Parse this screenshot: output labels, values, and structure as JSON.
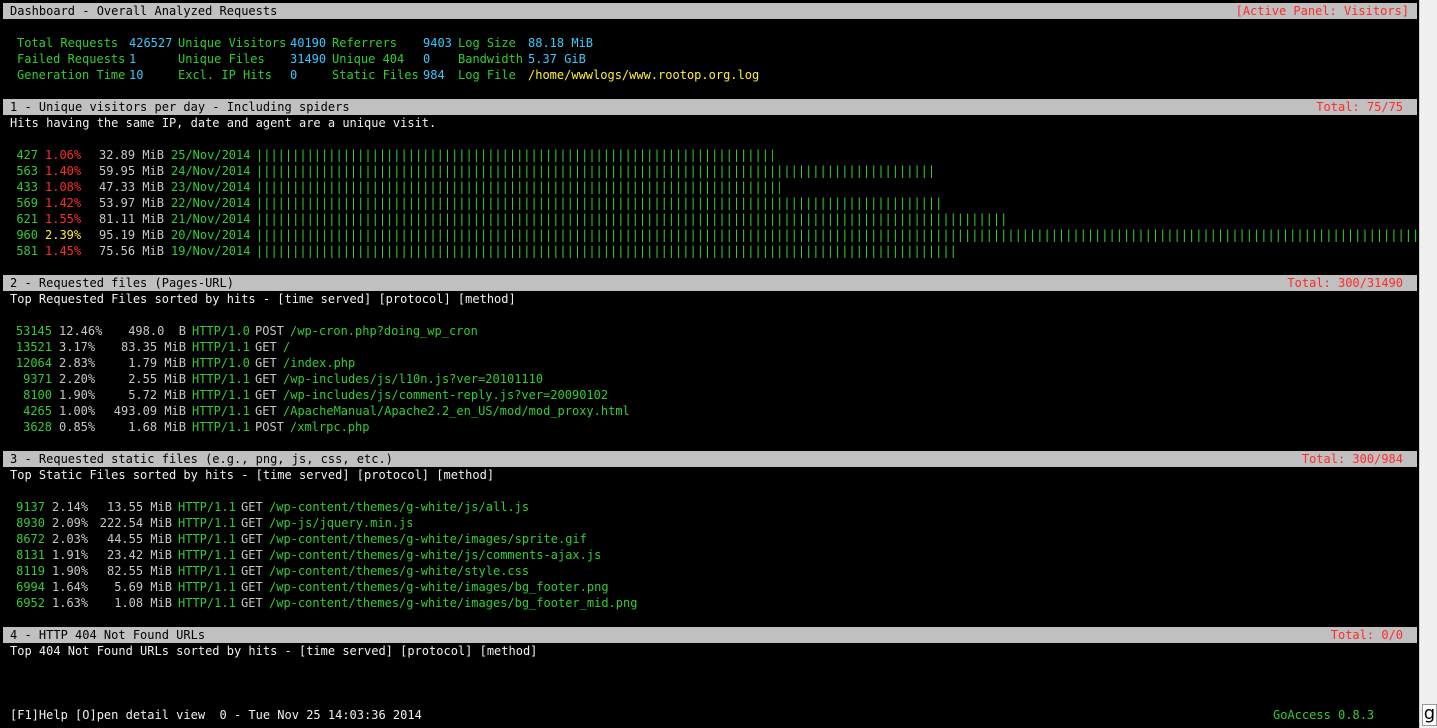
{
  "header": {
    "title": "Dashboard - Overall Analyzed Requests",
    "active_panel": "[Active Panel: Visitors]"
  },
  "summary": {
    "total_requests": {
      "label": "Total Requests",
      "value": "426527"
    },
    "unique_visitors": {
      "label": "Unique Visitors",
      "value": "40190"
    },
    "referrers": {
      "label": "Referrers",
      "value": "9403"
    },
    "log_size": {
      "label": "Log Size",
      "value": "88.18 MiB"
    },
    "failed_requests": {
      "label": "Failed Requests",
      "value": "1"
    },
    "unique_files": {
      "label": "Unique Files",
      "value": "31490"
    },
    "unique_404": {
      "label": "Unique 404",
      "value": "0"
    },
    "bandwidth": {
      "label": "Bandwidth",
      "value": "5.37 GiB"
    },
    "generation_time": {
      "label": "Generation Time",
      "value": "10"
    },
    "excl_ip_hits": {
      "label": "Excl. IP Hits",
      "value": "0"
    },
    "static_files": {
      "label": "Static Files",
      "value": "984"
    },
    "log_file": {
      "label": "Log File",
      "value": "/home/wwwlogs/www.rootop.org.log"
    }
  },
  "panels": {
    "visitors": {
      "title": "1 - Unique visitors per day - Including spiders",
      "total": "Total: 75/75",
      "description": "Hits having the same IP, date and agent are a unique visit.",
      "rows": [
        {
          "hits": "427",
          "percent": "1.06%",
          "pct_color": "red",
          "bandwidth": "32.89 MiB",
          "date": "25/Nov/2014",
          "bar_fraction": 0.445
        },
        {
          "hits": "563",
          "percent": "1.40%",
          "pct_color": "red",
          "bandwidth": "59.95 MiB",
          "date": "24/Nov/2014",
          "bar_fraction": 0.586
        },
        {
          "hits": "433",
          "percent": "1.08%",
          "pct_color": "red",
          "bandwidth": "47.33 MiB",
          "date": "23/Nov/2014",
          "bar_fraction": 0.451
        },
        {
          "hits": "569",
          "percent": "1.42%",
          "pct_color": "red",
          "bandwidth": "53.97 MiB",
          "date": "22/Nov/2014",
          "bar_fraction": 0.593
        },
        {
          "hits": "621",
          "percent": "1.55%",
          "pct_color": "red",
          "bandwidth": "81.11 MiB",
          "date": "21/Nov/2014",
          "bar_fraction": 0.647
        },
        {
          "hits": "960",
          "percent": "2.39%",
          "pct_color": "yellow",
          "bandwidth": "95.19 MiB",
          "date": "20/Nov/2014",
          "bar_fraction": 1.0
        },
        {
          "hits": "581",
          "percent": "1.45%",
          "pct_color": "red",
          "bandwidth": "75.56 MiB",
          "date": "19/Nov/2014",
          "bar_fraction": 0.605
        }
      ]
    },
    "requests": {
      "title": "2 - Requested files (Pages-URL)",
      "total": "Total: 300/31490",
      "description": "Top Requested Files sorted by hits - [time served] [protocol] [method]",
      "rows": [
        {
          "hits": "53145",
          "percent": "12.46%",
          "bandwidth": "498.0  B",
          "protocol": "HTTP/1.0",
          "method": "POST",
          "url": "/wp-cron.php?doing_wp_cron"
        },
        {
          "hits": "13521",
          "percent": "3.17%",
          "bandwidth": "83.35 MiB",
          "protocol": "HTTP/1.1",
          "method": "GET",
          "url": "/"
        },
        {
          "hits": "12064",
          "percent": "2.83%",
          "bandwidth": "1.79 MiB",
          "protocol": "HTTP/1.0",
          "method": "GET",
          "url": "/index.php"
        },
        {
          "hits": "9371",
          "percent": "2.20%",
          "bandwidth": "2.55 MiB",
          "protocol": "HTTP/1.1",
          "method": "GET",
          "url": "/wp-includes/js/l10n.js?ver=20101110"
        },
        {
          "hits": "8100",
          "percent": "1.90%",
          "bandwidth": "5.72 MiB",
          "protocol": "HTTP/1.1",
          "method": "GET",
          "url": "/wp-includes/js/comment-reply.js?ver=20090102"
        },
        {
          "hits": "4265",
          "percent": "1.00%",
          "bandwidth": "493.09 MiB",
          "protocol": "HTTP/1.1",
          "method": "GET",
          "url": "/ApacheManual/Apache2.2_en_US/mod/mod_proxy.html"
        },
        {
          "hits": "3628",
          "percent": "0.85%",
          "bandwidth": "1.68 MiB",
          "protocol": "HTTP/1.1",
          "method": "POST",
          "url": "/xmlrpc.php"
        }
      ]
    },
    "static": {
      "title": "3 - Requested static files (e.g., png, js, css, etc.)",
      "total": "Total: 300/984",
      "description": "Top Static Files sorted by hits - [time served] [protocol] [method]",
      "rows": [
        {
          "hits": "9137",
          "percent": "2.14%",
          "bandwidth": "13.55 MiB",
          "protocol": "HTTP/1.1",
          "method": "GET",
          "url": "/wp-content/themes/g-white/js/all.js"
        },
        {
          "hits": "8930",
          "percent": "2.09%",
          "bandwidth": "222.54 MiB",
          "protocol": "HTTP/1.1",
          "method": "GET",
          "url": "/wp-js/jquery.min.js"
        },
        {
          "hits": "8672",
          "percent": "2.03%",
          "bandwidth": "44.55 MiB",
          "protocol": "HTTP/1.1",
          "method": "GET",
          "url": "/wp-content/themes/g-white/images/sprite.gif"
        },
        {
          "hits": "8131",
          "percent": "1.91%",
          "bandwidth": "23.42 MiB",
          "protocol": "HTTP/1.1",
          "method": "GET",
          "url": "/wp-content/themes/g-white/js/comments-ajax.js"
        },
        {
          "hits": "8119",
          "percent": "1.90%",
          "bandwidth": "82.55 MiB",
          "protocol": "HTTP/1.1",
          "method": "GET",
          "url": "/wp-content/themes/g-white/style.css"
        },
        {
          "hits": "6994",
          "percent": "1.64%",
          "bandwidth": "5.69 MiB",
          "protocol": "HTTP/1.1",
          "method": "GET",
          "url": "/wp-content/themes/g-white/images/bg_footer.png"
        },
        {
          "hits": "6952",
          "percent": "1.63%",
          "bandwidth": "1.08 MiB",
          "protocol": "HTTP/1.1",
          "method": "GET",
          "url": "/wp-content/themes/g-white/images/bg_footer_mid.png"
        }
      ]
    },
    "notfound": {
      "title": "4 - HTTP 404 Not Found URLs",
      "total": "Total: 0/0",
      "description": "Top 404 Not Found URLs sorted by hits - [time served] [protocol] [method]"
    }
  },
  "footer": {
    "help": "[F1]Help [O]pen detail view  0 - Tue Nov 25 14:03:36 2014",
    "app": "GoAccess 0.8.3"
  },
  "scrollbar": {
    "glyph": "g"
  },
  "colors": {
    "green": "#33cc33",
    "cyan": "#3cc8ff",
    "yellow": "#ffee33",
    "red": "#ff2a2a",
    "bar_bg": "#c0c0c0",
    "active": "#0000c8"
  }
}
